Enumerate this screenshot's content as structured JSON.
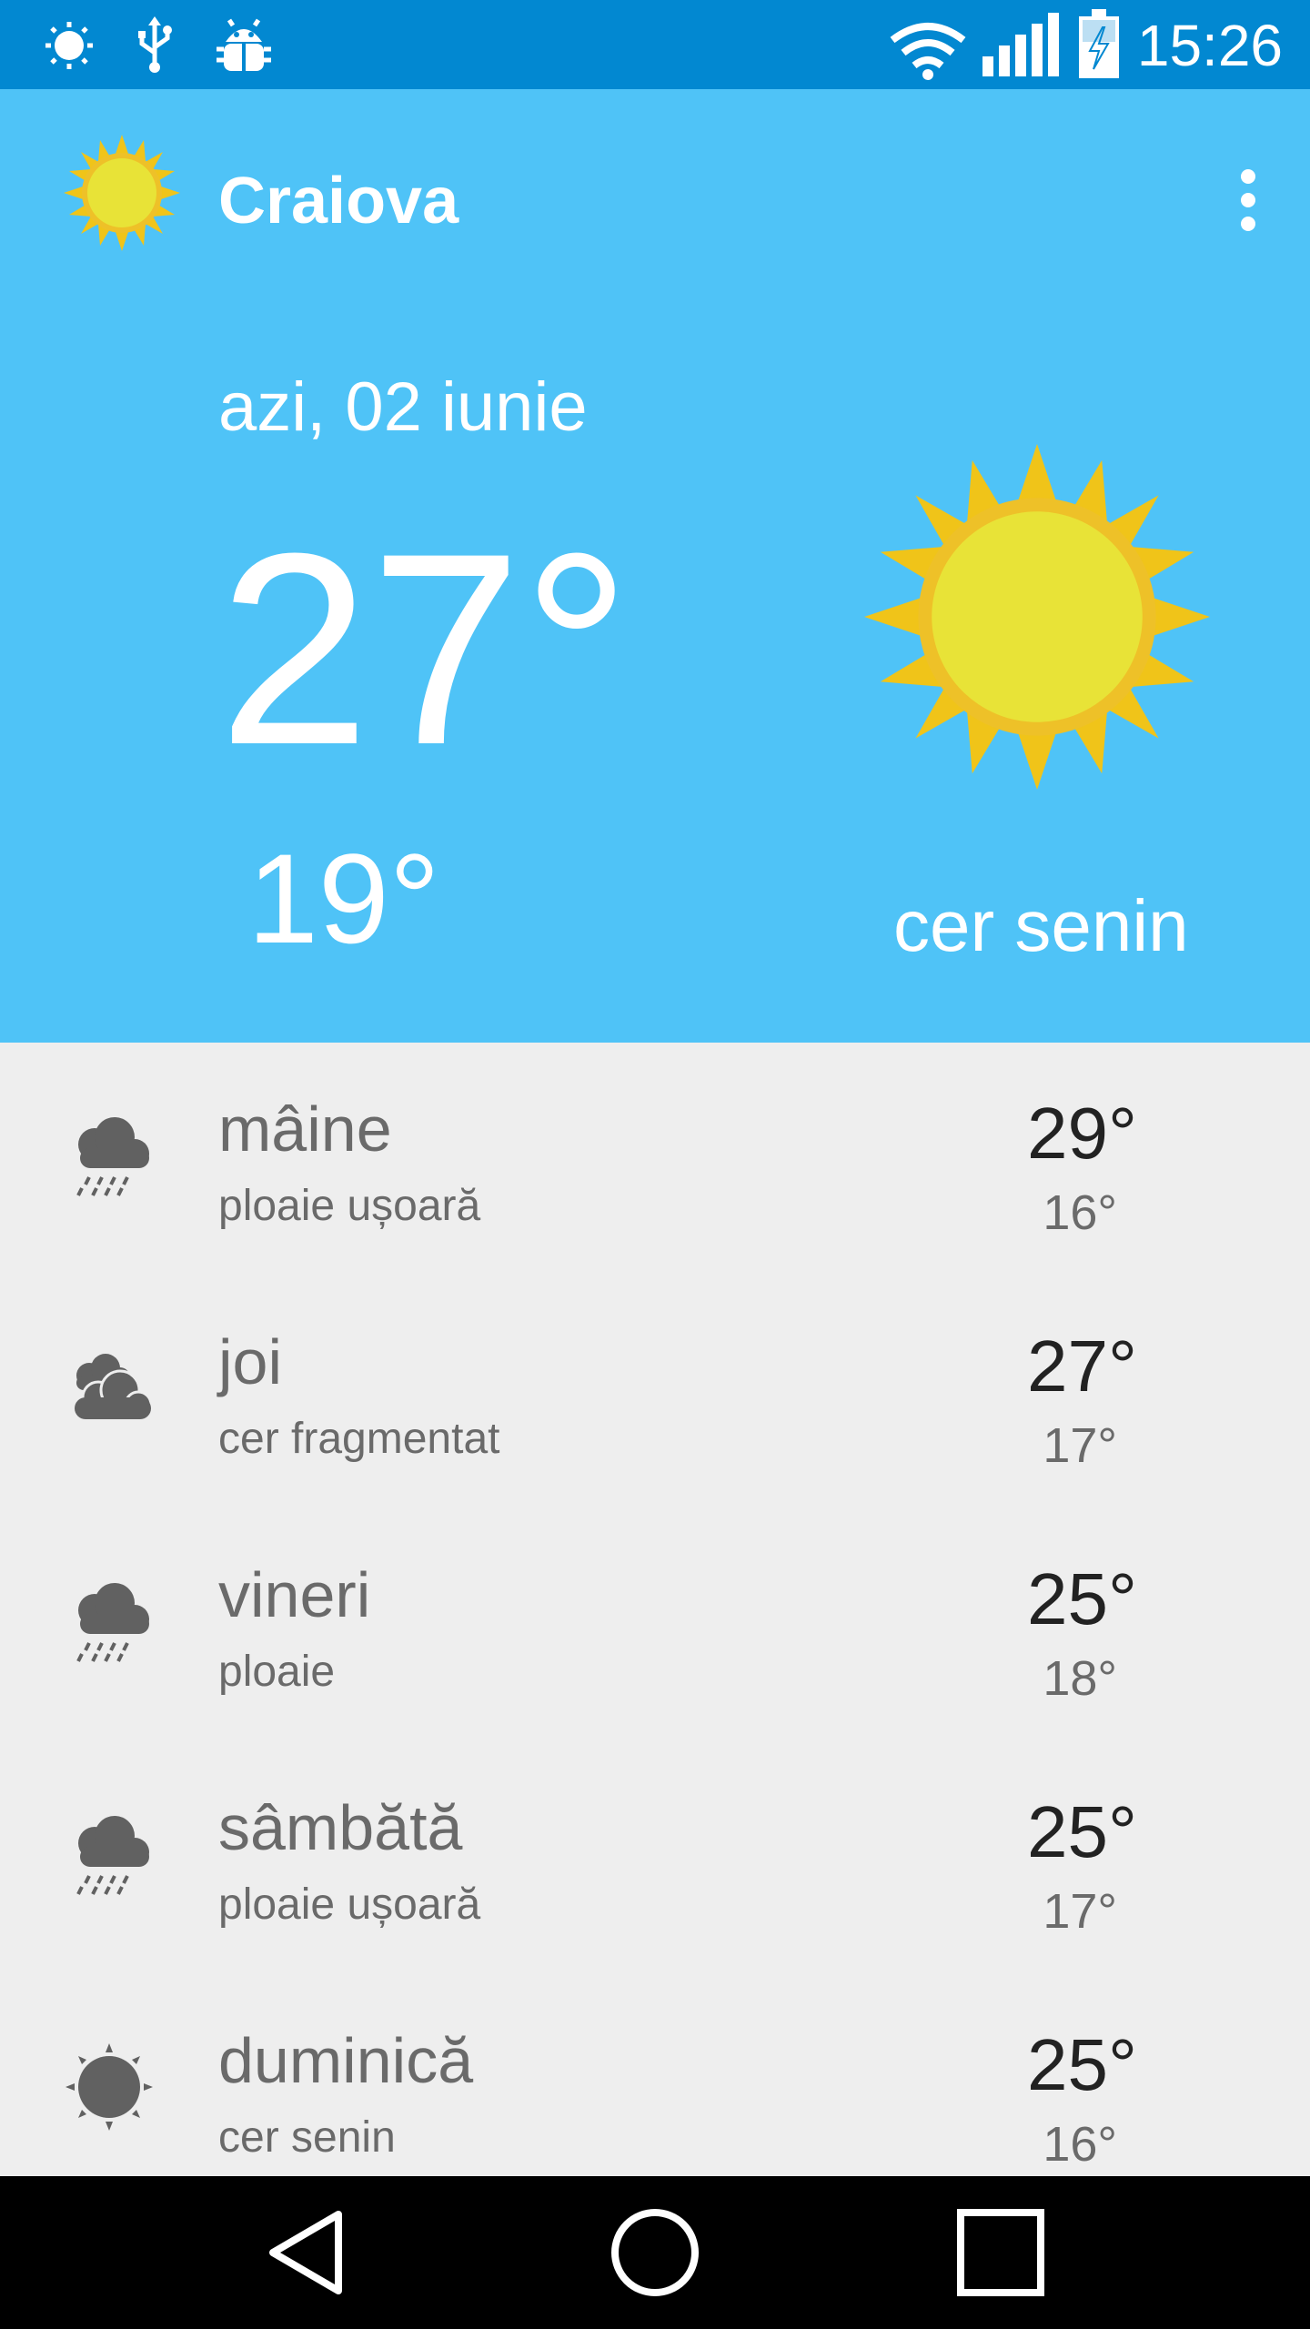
{
  "status_bar": {
    "time": "15:26",
    "left_icons": [
      "brightness-icon",
      "usb-icon",
      "android-debug-icon"
    ],
    "right_icons": [
      "wifi-icon",
      "signal-icon",
      "battery-charging-icon"
    ]
  },
  "app_bar": {
    "title": "Craiova",
    "logo_icon": "sun-icon",
    "menu_icon": "more-vert-icon"
  },
  "today": {
    "date": "azi, 02 iunie",
    "high": "27°",
    "low": "19°",
    "condition": "cer senin",
    "icon": "sun-icon"
  },
  "forecast": [
    {
      "day": "mâine",
      "desc": "ploaie ușoară",
      "high": "29°",
      "low": "16°",
      "icon": "rain-cloud-icon"
    },
    {
      "day": "joi",
      "desc": "cer fragmentat",
      "high": "27°",
      "low": "17°",
      "icon": "broken-clouds-icon"
    },
    {
      "day": "vineri",
      "desc": "ploaie",
      "high": "25°",
      "low": "18°",
      "icon": "rain-cloud-icon"
    },
    {
      "day": "sâmbătă",
      "desc": "ploaie ușoară",
      "high": "25°",
      "low": "17°",
      "icon": "rain-cloud-icon"
    },
    {
      "day": "duminică",
      "desc": "cer senin",
      "high": "25°",
      "low": "16°",
      "icon": "clear-sun-icon"
    }
  ],
  "nav_bar": {
    "buttons": [
      "back-icon",
      "home-icon",
      "recents-icon"
    ]
  },
  "colors": {
    "status_bar": "#0288d1",
    "app_bar": "#4fc3f7",
    "list_bg": "#eeeeee",
    "sun_yellow": "#e8e337",
    "sun_rays": "#f0c419",
    "icon_gray": "#616161"
  }
}
